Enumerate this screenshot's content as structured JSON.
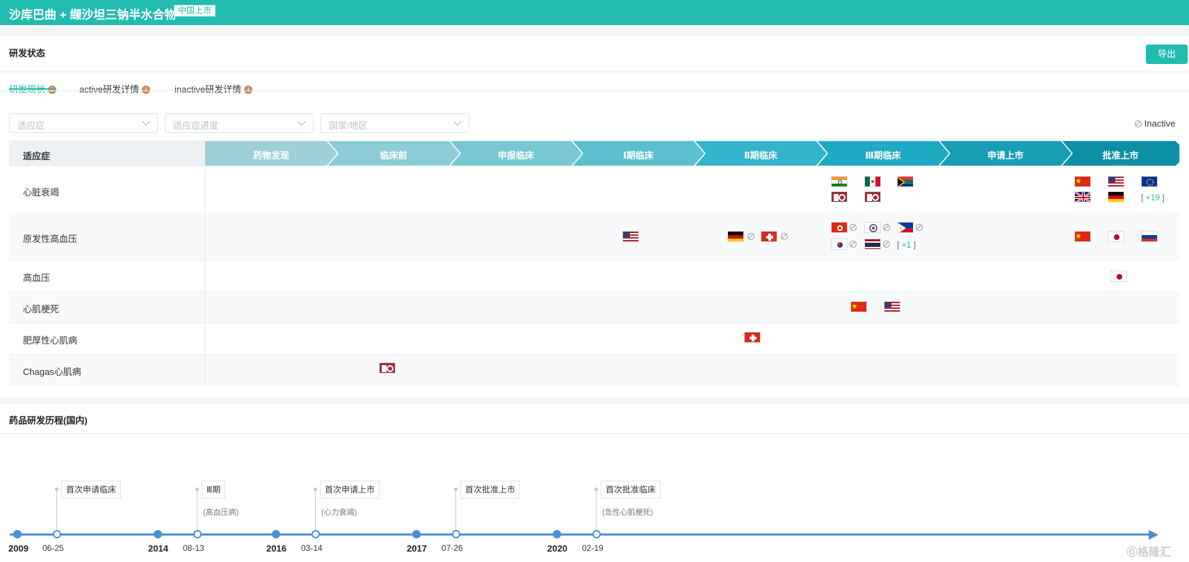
{
  "header": {
    "title": "沙库巴曲 + 缬沙坦三钠半水合物",
    "tag": "中国上市"
  },
  "status": {
    "section_title": "研发状态",
    "export_label": "导出",
    "tabs": [
      {
        "label": "研发现状"
      },
      {
        "label": "active研发详情"
      },
      {
        "label": "inactive研发详情"
      }
    ],
    "filters": [
      {
        "placeholder": "适应症"
      },
      {
        "placeholder": "适应症进度"
      },
      {
        "placeholder": "国家/地区"
      }
    ],
    "legend_label": "Inactive",
    "table_header": "适应症",
    "phases": [
      "药物发现",
      "临床前",
      "申报临床",
      "Ⅰ期临床",
      "Ⅱ期临床",
      "Ⅲ期临床",
      "申请上市",
      "批准上市"
    ],
    "phase_colors": [
      "#9fd0d8",
      "#8ccdd5",
      "#78c7d2",
      "#5bbfcf",
      "#33b4cb",
      "#1fa9c2",
      "#179db5",
      "#0d8fa6"
    ],
    "rows": [
      {
        "name": "心脏衰竭",
        "more": "+19"
      },
      {
        "name": "原发性高血压",
        "more": "+1"
      },
      {
        "name": "高血压"
      },
      {
        "name": "心肌梗死"
      },
      {
        "name": "肥厚性心肌病"
      },
      {
        "name": "Chagas心肌病"
      }
    ]
  },
  "timeline": {
    "section_title": "药品研发历程(国内)",
    "years": [
      "2009",
      "2014",
      "2016",
      "2017",
      "2020"
    ],
    "events": [
      {
        "date": "06-25",
        "label": "首次申请临床",
        "sub": ""
      },
      {
        "date": "08-13",
        "label": "Ⅲ期",
        "sub": "(高血压病)"
      },
      {
        "date": "03-14",
        "label": "首次申请上市",
        "sub": "(心力衰竭)"
      },
      {
        "date": "07-26",
        "label": "首次批准上市",
        "sub": ""
      },
      {
        "date": "02-19",
        "label": "首次批准临床",
        "sub": "(急性心肌梗死)"
      }
    ],
    "watermark": "格隆汇"
  }
}
